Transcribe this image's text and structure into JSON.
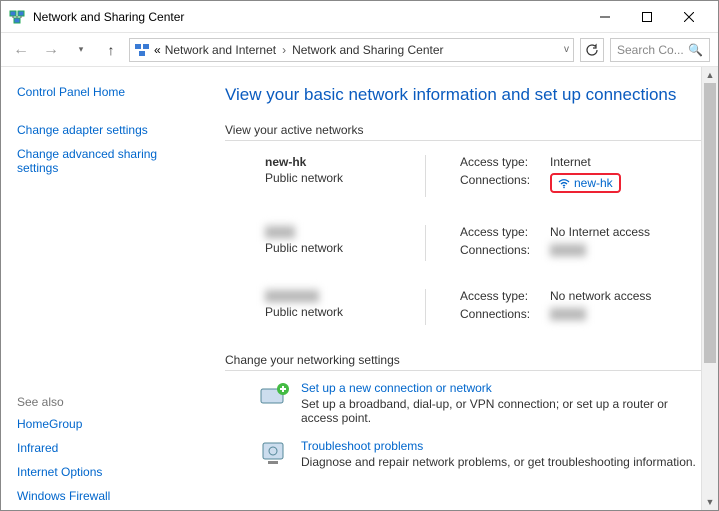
{
  "window": {
    "title": "Network and Sharing Center"
  },
  "breadcrumb": {
    "prefix": "«",
    "item1": "Network and Internet",
    "item2": "Network and Sharing Center"
  },
  "search": {
    "placeholder": "Search Co..."
  },
  "sidebar": {
    "home": "Control Panel Home",
    "adapter": "Change adapter settings",
    "advanced": "Change advanced sharing settings",
    "see_also": "See also",
    "homegroup": "HomeGroup",
    "infrared": "Infrared",
    "internet_options": "Internet Options",
    "firewall": "Windows Firewall"
  },
  "main": {
    "heading": "View your basic network information and set up connections",
    "active_networks_label": "View your active networks",
    "change_settings_label": "Change your networking settings",
    "access_type_label": "Access type:",
    "connections_label": "Connections:",
    "public_network": "Public network",
    "networks": [
      {
        "name": "new-hk",
        "access": "Internet",
        "conn": "new-hk",
        "blurred": false
      },
      {
        "name": "xxxxx",
        "access": "No Internet access",
        "conn": "xxxxxx",
        "blurred": true
      },
      {
        "name": "xxxxxxxxx",
        "access": "No network access",
        "conn": "xxxxxx",
        "blurred": true
      }
    ],
    "setup": {
      "link": "Set up a new connection or network",
      "desc": "Set up a broadband, dial-up, or VPN connection; or set up a router or access point."
    },
    "troubleshoot": {
      "link": "Troubleshoot problems",
      "desc": "Diagnose and repair network problems, or get troubleshooting information."
    }
  }
}
